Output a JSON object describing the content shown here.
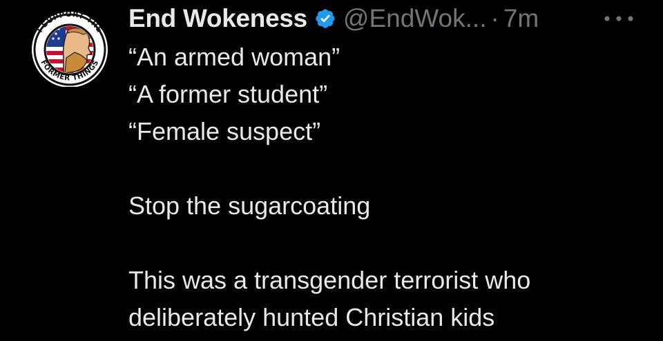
{
  "tweet": {
    "display_name": "End Wokeness",
    "handle": "@EndWok...",
    "separator": "·",
    "time": "7m",
    "avatar_text_top": "I SUPPORT THE",
    "avatar_text_bottom": "FORMER THINGS",
    "lines": [
      "“An armed woman”",
      "“A former student”",
      "“Female suspect”",
      "Stop the sugarcoating",
      "This was a transgender terrorist who",
      "deliberately hunted Christian kids"
    ]
  },
  "colors": {
    "background": "#000000",
    "text": "#e7e9ea",
    "muted": "#71767b",
    "verified": "#1d9bf0"
  },
  "icons": {
    "verified": "verified-badge-icon",
    "more": "more-options-icon"
  }
}
